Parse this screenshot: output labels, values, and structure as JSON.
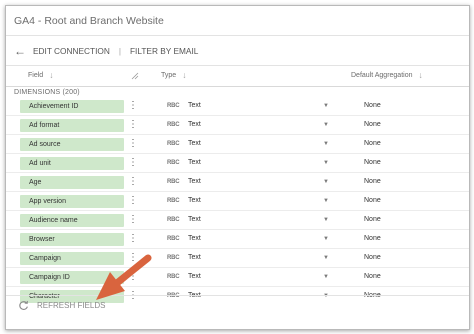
{
  "window": {
    "title": "GA4 - Root and Branch Website"
  },
  "toolbar": {
    "back_icon": "arrow-left-icon",
    "edit_label": "EDIT CONNECTION",
    "separator": "|",
    "filter_label": "FILTER BY EMAIL"
  },
  "columns": {
    "field": "Field",
    "type": "Type",
    "aggregation": "Default Aggregation",
    "sort_icon": "arrow-down-icon"
  },
  "section": {
    "label": "DIMENSIONS (200)"
  },
  "type_badge": "RBC",
  "fields": [
    {
      "name": "Achievement ID",
      "type": "Text",
      "aggregation": "None"
    },
    {
      "name": "Ad format",
      "type": "Text",
      "aggregation": "None"
    },
    {
      "name": "Ad source",
      "type": "Text",
      "aggregation": "None"
    },
    {
      "name": "Ad unit",
      "type": "Text",
      "aggregation": "None"
    },
    {
      "name": "Age",
      "type": "Text",
      "aggregation": "None"
    },
    {
      "name": "App version",
      "type": "Text",
      "aggregation": "None"
    },
    {
      "name": "Audience name",
      "type": "Text",
      "aggregation": "None"
    },
    {
      "name": "Browser",
      "type": "Text",
      "aggregation": "None"
    },
    {
      "name": "Campaign",
      "type": "Text",
      "aggregation": "None"
    },
    {
      "name": "Campaign ID",
      "type": "Text",
      "aggregation": "None"
    },
    {
      "name": "Character",
      "type": "Text",
      "aggregation": "None"
    }
  ],
  "footer": {
    "refresh_label": "REFRESH FIELDS",
    "refresh_icon": "refresh-icon"
  },
  "colors": {
    "chip": "#cfe8cb",
    "annotation_arrow": "#d9643e"
  }
}
